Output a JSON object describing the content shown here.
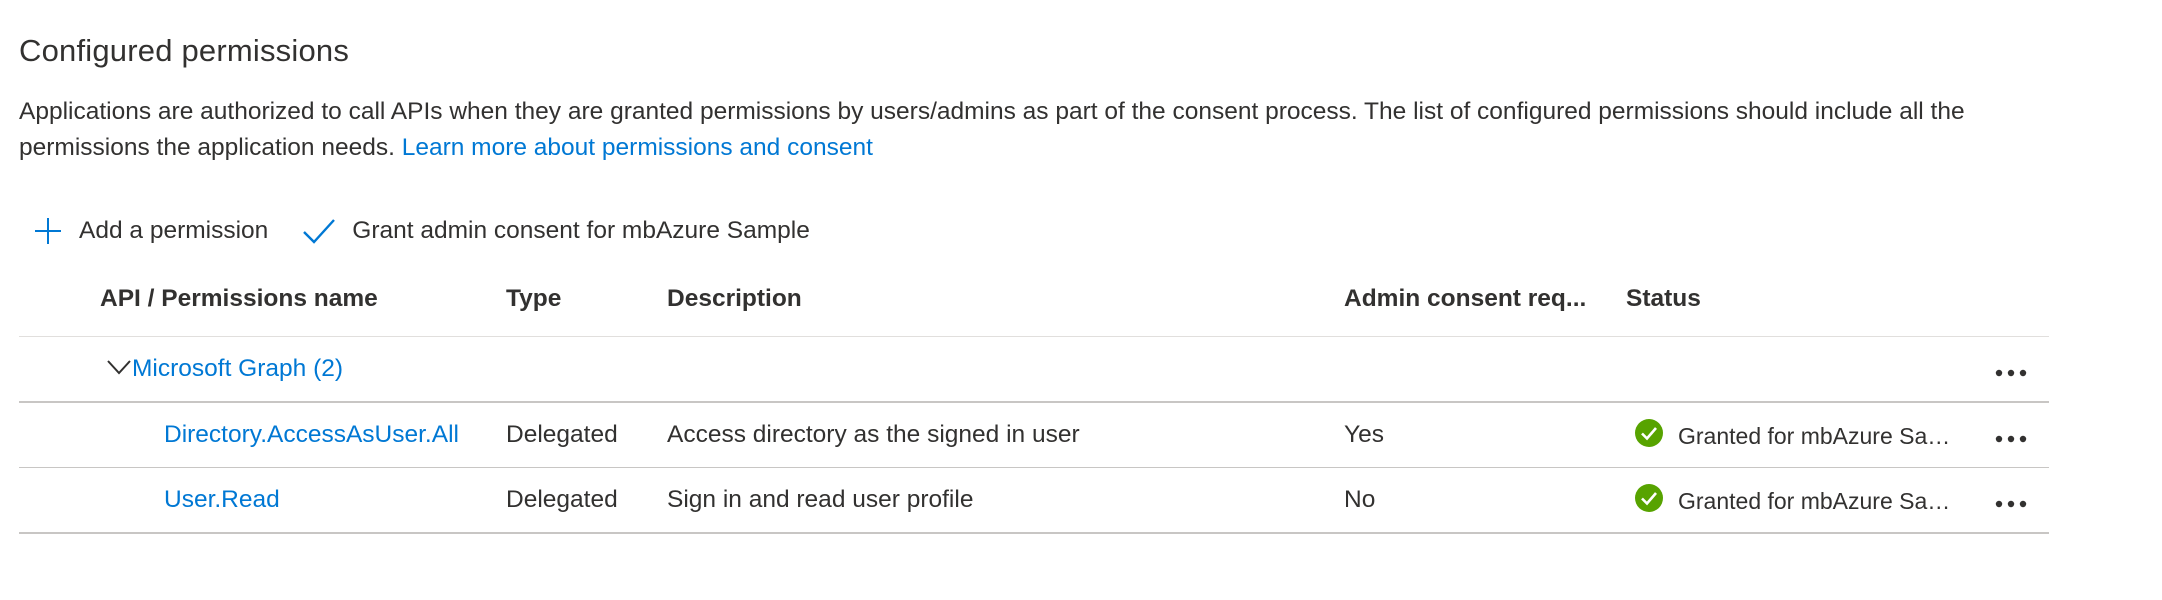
{
  "section": {
    "title": "Configured permissions",
    "description_text": "Applications are authorized to call APIs when they are granted permissions by users/admins as part of the consent process. The list of configured permissions should include all the permissions the application needs.",
    "learn_more_link": "Learn more about permissions and consent"
  },
  "toolbar": {
    "add_permission": "Add a permission",
    "grant_consent": "Grant admin consent for mbAzure Sample"
  },
  "table": {
    "headers": {
      "name": "API / Permissions name",
      "type": "Type",
      "description": "Description",
      "admin_consent": "Admin consent req...",
      "status": "Status"
    },
    "group": {
      "label": "Microsoft Graph (2)"
    },
    "rows": [
      {
        "name": "Directory.AccessAsUser.All",
        "type": "Delegated",
        "description": "Access directory as the signed in user",
        "admin_consent": "Yes",
        "status": "Granted for mbAzure Sample"
      },
      {
        "name": "User.Read",
        "type": "Delegated",
        "description": "Sign in and read user profile",
        "admin_consent": "No",
        "status": "Granted for mbAzure Sample"
      }
    ]
  },
  "colors": {
    "accent": "#0078d4",
    "success": "#57a300",
    "text": "#323130",
    "divider": "#c8c6c4"
  },
  "icons": {
    "add": "plus-icon",
    "grant": "checkmark-icon",
    "expand": "chevron-down-icon",
    "more": "more-icon",
    "status": "check-circle-icon"
  }
}
